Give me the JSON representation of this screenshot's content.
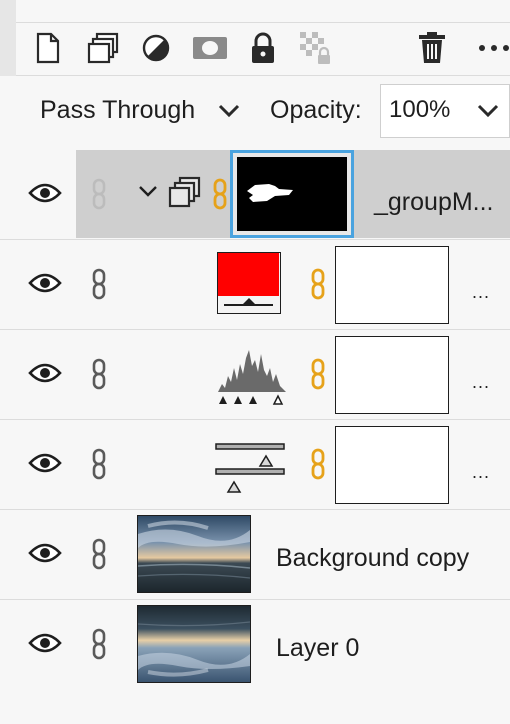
{
  "toolbar": {
    "icons": [
      "new-layer-icon",
      "group-icon",
      "adjustment-icon",
      "mask-icon",
      "lock-icon",
      "lock-transparency-icon",
      "trash-icon",
      "more-icon"
    ]
  },
  "blend": {
    "mode": "Pass Through",
    "opacity_label": "Opacity:",
    "opacity_value": "100%"
  },
  "layers": [
    {
      "type": "group",
      "name": "_groupM...",
      "selected": true,
      "visible": true
    },
    {
      "type": "solid-color",
      "name": "...",
      "color": "#ff0000",
      "visible": true
    },
    {
      "type": "levels",
      "name": "...",
      "visible": true
    },
    {
      "type": "curves",
      "name": "...",
      "visible": true
    },
    {
      "type": "image",
      "name": "Background copy",
      "visible": true
    },
    {
      "type": "image",
      "name": "Layer 0",
      "visible": true
    }
  ],
  "colors": {
    "link_active": "#e6a21a",
    "selection_border": "#4aa3df",
    "panel_bg": "#f7f7f7",
    "selected_row": "#cfcfcf"
  }
}
